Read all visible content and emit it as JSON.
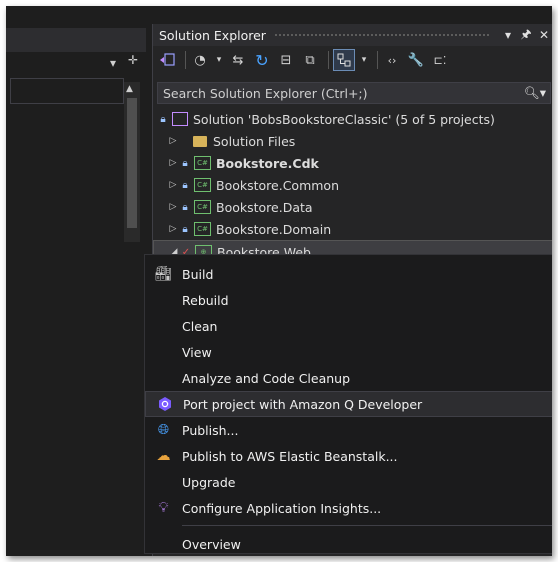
{
  "colors": {
    "background": "#1e1e1e",
    "panel": "#252526",
    "menu": "#1b1b1c",
    "accent": "#6b8cb5",
    "project_green": "#6fbf6f",
    "q_purple": "#7b5cff"
  },
  "left_panel": {
    "dropdown_icon": "chevron-down-icon",
    "gear_icon": "gear-icon",
    "split_icon": "split-icon"
  },
  "solution_explorer": {
    "title": "Solution Explorer",
    "title_buttons": {
      "dropdown": "▾",
      "pin": "🖈",
      "close": "✕"
    },
    "toolbar": [
      "switch-views-icon",
      "pending-changes-icon",
      "back-forward-icon",
      "refresh-icon",
      "collapse-all-icon",
      "show-all-files-icon",
      "sync-icon",
      "view-code-icon",
      "properties-icon",
      "preview-icon"
    ],
    "search": {
      "placeholder": "Search Solution Explorer (Ctrl+;)"
    },
    "tree": {
      "solution": "Solution 'BobsBookstoreClassic' (5 of 5 projects)",
      "items": [
        {
          "label": "Solution Files",
          "type": "folder"
        },
        {
          "label": "Bookstore.Cdk",
          "type": "project",
          "bold": true
        },
        {
          "label": "Bookstore.Common",
          "type": "project"
        },
        {
          "label": "Bookstore.Data",
          "type": "project"
        },
        {
          "label": "Bookstore.Domain",
          "type": "project"
        },
        {
          "label": "Bookstore.Web",
          "type": "project",
          "selected": true
        }
      ]
    }
  },
  "context_menu": {
    "items": [
      {
        "label": "Build",
        "icon": "build-icon"
      },
      {
        "label": "Rebuild"
      },
      {
        "label": "Clean"
      },
      {
        "label": "View"
      },
      {
        "label": "Analyze and Code Cleanup"
      },
      {
        "label": "Port project with Amazon Q Developer",
        "icon": "amazon-q-icon",
        "highlighted": true
      },
      {
        "label": "Publish...",
        "icon": "globe-icon"
      },
      {
        "label": "Publish to AWS Elastic Beanstalk...",
        "icon": "beanstalk-icon"
      },
      {
        "label": "Upgrade"
      },
      {
        "label": "Configure Application Insights...",
        "icon": "insights-icon"
      },
      {
        "label": "Overview"
      }
    ]
  }
}
